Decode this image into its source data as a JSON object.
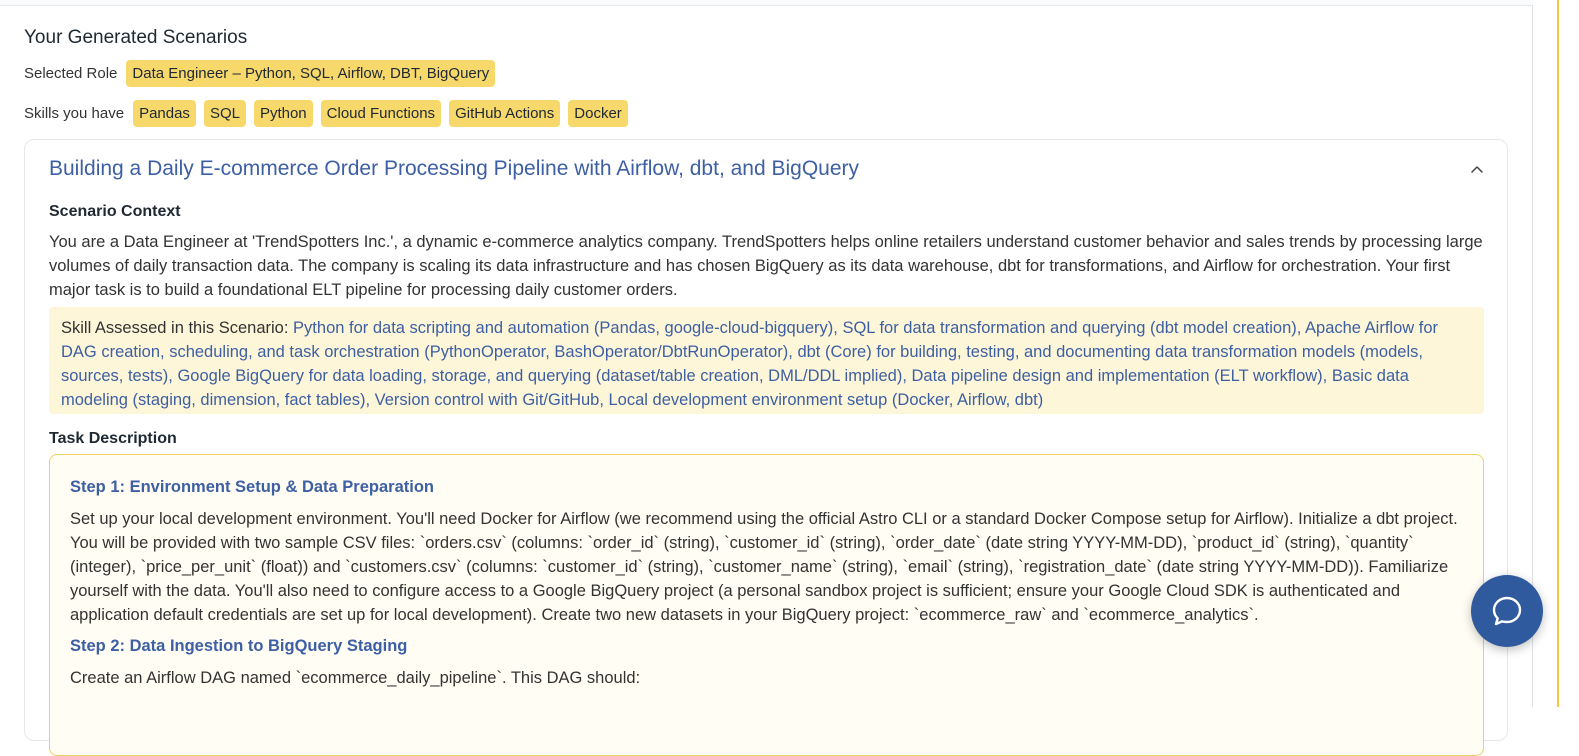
{
  "page": {
    "title": "Your Generated Scenarios"
  },
  "role": {
    "label": "Selected Role",
    "value": "Data Engineer – Python, SQL, Airflow, DBT, BigQuery"
  },
  "skills": {
    "label": "Skills you have",
    "items": [
      "Pandas",
      "SQL",
      "Python",
      "Cloud Functions",
      "GitHub Actions",
      "Docker"
    ]
  },
  "scenario": {
    "title": "Building a Daily E-commerce Order Processing Pipeline with Airflow, dbt, and BigQuery",
    "context_label": "Scenario Context",
    "context_text": "You are a Data Engineer at 'TrendSpotters Inc.', a dynamic e-commerce analytics company. TrendSpotters helps online retailers understand customer behavior and sales trends by processing large volumes of daily transaction data. The company is scaling its data infrastructure and has chosen BigQuery as its data warehouse, dbt for transformations, and Airflow for orchestration. Your first major task is to build a foundational ELT pipeline for processing daily customer orders.",
    "skill_assessed_label": "Skill Assessed in this Scenario:",
    "skill_assessed_text": "Python for data scripting and automation (Pandas, google-cloud-bigquery), SQL for data transformation and querying (dbt model creation), Apache Airflow for DAG creation, scheduling, and task orchestration (PythonOperator, BashOperator/DbtRunOperator), dbt (Core) for building, testing, and documenting data transformation models (models, sources, tests), Google BigQuery for data loading, storage, and querying (dataset/table creation, DML/DDL implied), Data pipeline design and implementation (ELT workflow), Basic data modeling (staging, dimension, fact tables), Version control with Git/GitHub, Local development environment setup (Docker, Airflow, dbt)",
    "task_label": "Task Description",
    "steps": [
      {
        "title": "Step 1: Environment Setup & Data Preparation",
        "text": "Set up your local development environment. You'll need Docker for Airflow (we recommend using the official Astro CLI or a standard Docker Compose setup for Airflow). Initialize a dbt project. You will be provided with two sample CSV files: `orders.csv` (columns: `order_id` (string), `customer_id` (string), `order_date` (date string YYYY-MM-DD), `product_id` (string), `quantity` (integer), `price_per_unit` (float)) and `customers.csv` (columns: `customer_id` (string), `customer_name` (string), `email` (string), `registration_date` (date string YYYY-MM-DD)). Familiarize yourself with the data. You'll also need to configure access to a Google BigQuery project (a personal sandbox project is sufficient; ensure your Google Cloud SDK is authenticated and application default credentials are set up for local development). Create two new datasets in your BigQuery project: `ecommerce_raw` and `ecommerce_analytics`."
      },
      {
        "title": "Step 2: Data Ingestion to BigQuery Staging",
        "text": "Create an Airflow DAG named `ecommerce_daily_pipeline`. This DAG should:"
      }
    ]
  },
  "colors": {
    "accent": "#3d5fa3",
    "chip": "#f7d86b",
    "skill_box_bg": "#fdf6d9",
    "task_border": "#f0d064",
    "chat_button": "#2f5a9e"
  }
}
